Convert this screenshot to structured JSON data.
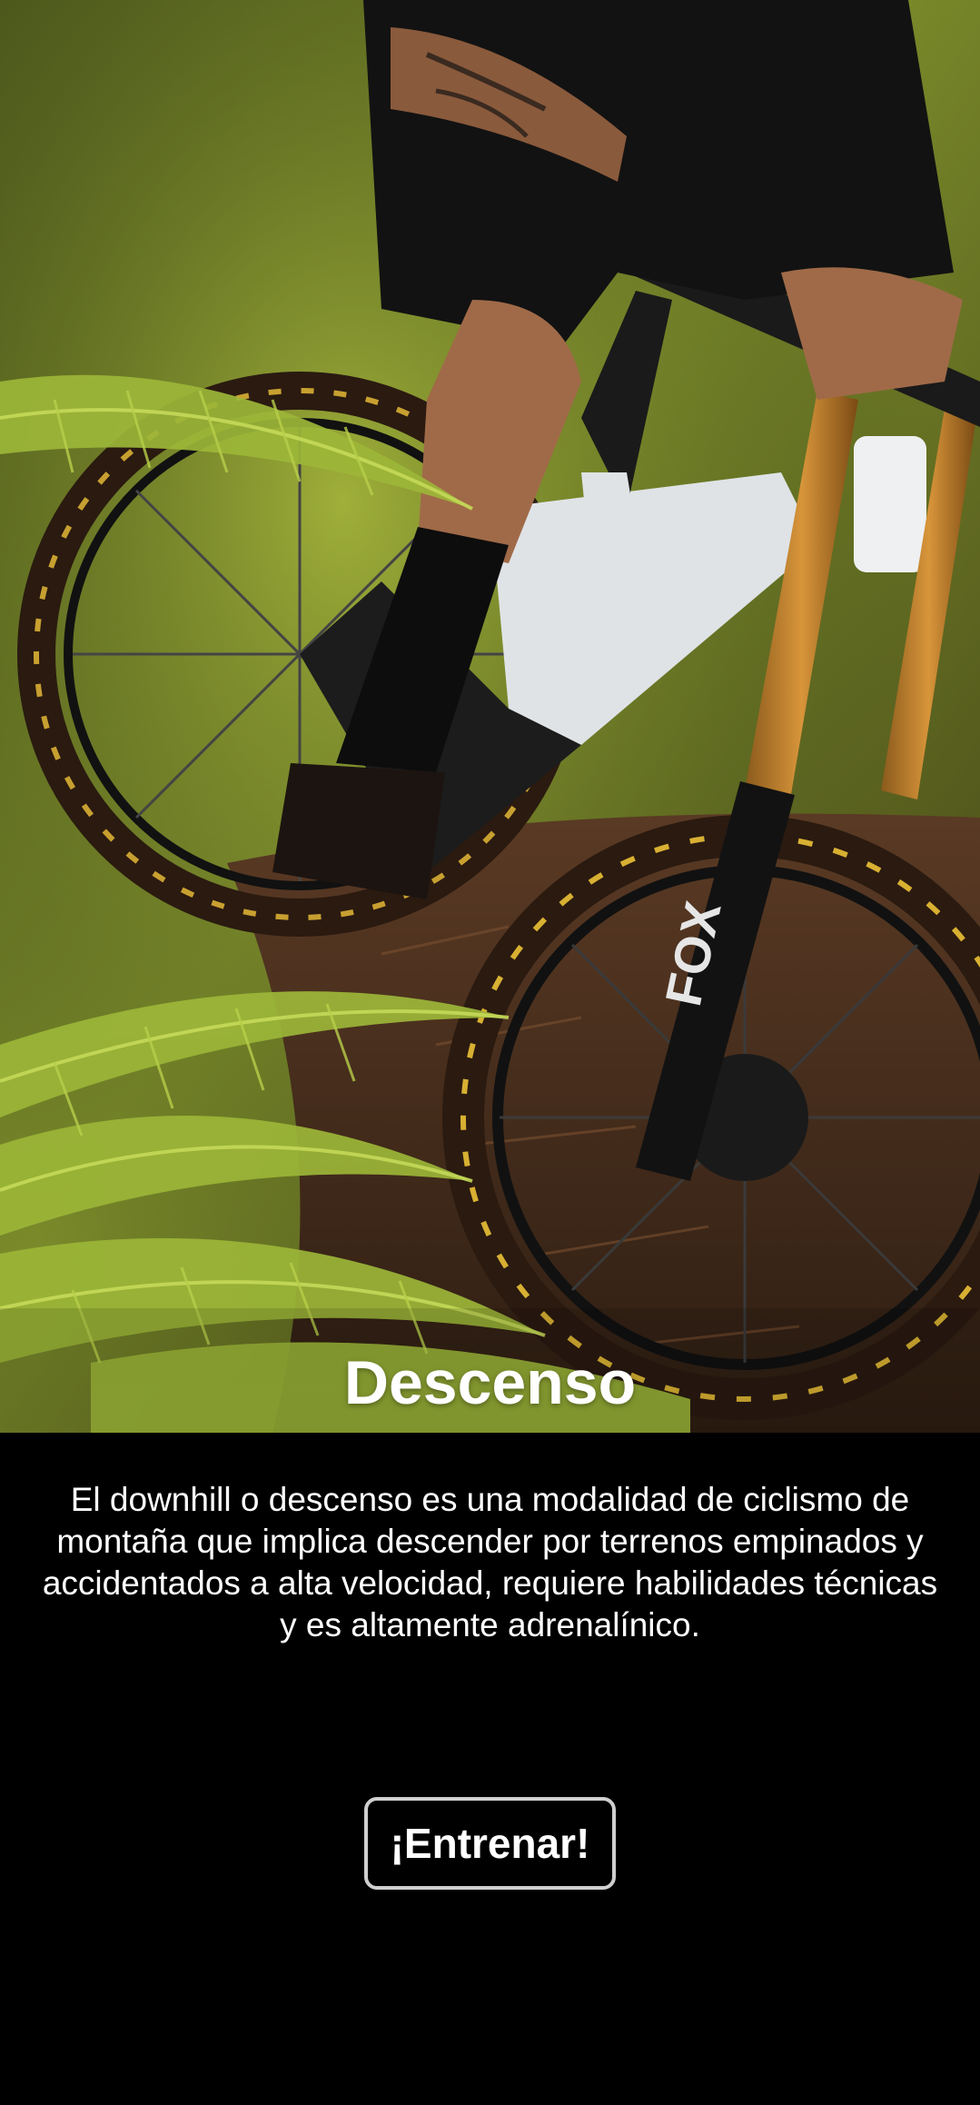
{
  "hero": {
    "title": "Descenso",
    "image_subject": "downhill-mountain-biker-photo"
  },
  "content": {
    "description": "El downhill o descenso es una modalidad de ciclismo de montaña que implica descender por terrenos empinados y accidentados a alta velocidad, requiere habilidades técnicas y es altamente adrenalínico."
  },
  "actions": {
    "train_label": "¡Entrenar!"
  },
  "colors": {
    "background": "#000000",
    "text": "#ffffff",
    "button_border": "#cfcfcf"
  }
}
